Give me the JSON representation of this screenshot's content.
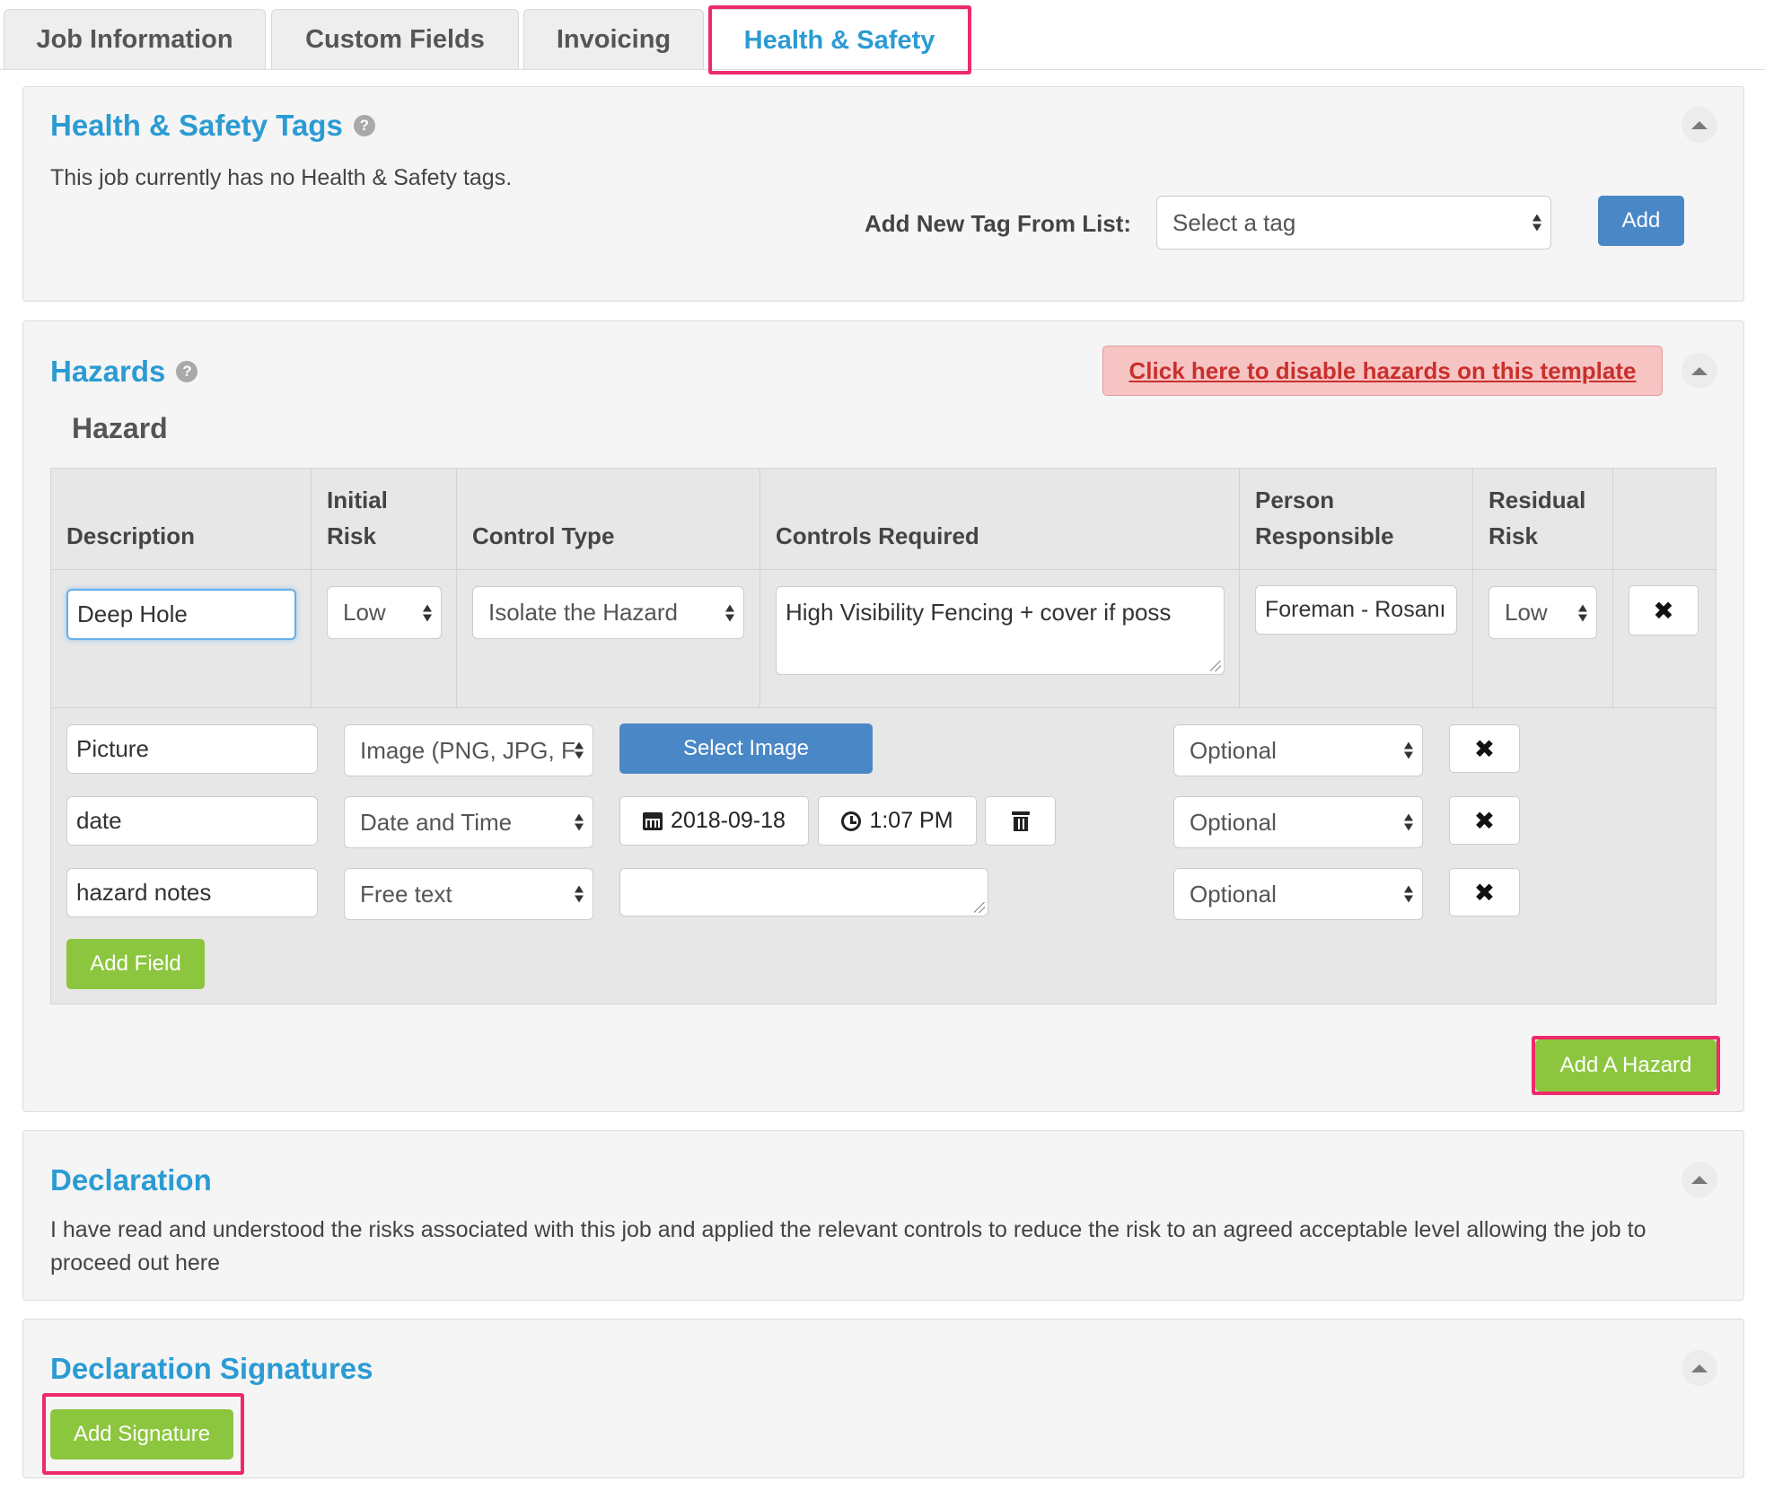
{
  "tabs": [
    "Job Information",
    "Custom Fields",
    "Invoicing",
    "Health & Safety"
  ],
  "tags_panel": {
    "title": "Health & Safety Tags",
    "empty_text": "This job currently has no Health & Safety tags.",
    "add_label": "Add New Tag From List:",
    "select_value": "Select a tag",
    "add_button": "Add"
  },
  "hazards_panel": {
    "title": "Hazards",
    "disable_link": "Click here to disable hazards on this template",
    "subtitle": "Hazard",
    "columns": {
      "description": "Description",
      "initial_risk_1": "Initial",
      "initial_risk_2": "Risk",
      "control_type": "Control Type",
      "controls_required": "Controls Required",
      "person_responsible_1": "Person",
      "person_responsible_2": "Responsible",
      "residual_risk_1": "Residual",
      "residual_risk_2": "Risk"
    },
    "hazard_row": {
      "description": "Deep Hole",
      "initial_risk": "Low",
      "control_type": "Isolate the Hazard",
      "controls_required": "High Visibility Fencing + cover if poss",
      "person_responsible": "Foreman - Rosanı",
      "residual_risk": "Low"
    },
    "fields": [
      {
        "name": "Picture",
        "type": "Image (PNG, JPG, F",
        "action": "Select Image",
        "required": "Optional"
      },
      {
        "name": "date",
        "type": "Date and Time",
        "date": "2018-09-18",
        "time": "1:07 PM",
        "required": "Optional"
      },
      {
        "name": "hazard notes",
        "type": "Free text",
        "value": "",
        "required": "Optional"
      }
    ],
    "add_field_button": "Add Field",
    "add_hazard_button": "Add A Hazard"
  },
  "declaration_panel": {
    "title": "Declaration",
    "line1": "I have read and understood the risks associated with this job and applied the relevant controls to reduce the risk to an agreed acceptable level allowing the job to",
    "line2": "proceed out here"
  },
  "signatures_panel": {
    "title": "Declaration Signatures",
    "add_button": "Add Signature"
  },
  "colors": {
    "heading_blue": "#2b9bd3",
    "button_blue": "#4a87c6",
    "button_green": "#8cc63e",
    "highlight_pink": "#ee2a6a",
    "alert_red": "#c9302c",
    "alert_bg": "#f7c4c4"
  },
  "icons": [
    "help-icon",
    "chevron-up-icon",
    "select-arrows-icon",
    "close-icon",
    "calendar-icon",
    "clock-icon",
    "trash-icon"
  ]
}
